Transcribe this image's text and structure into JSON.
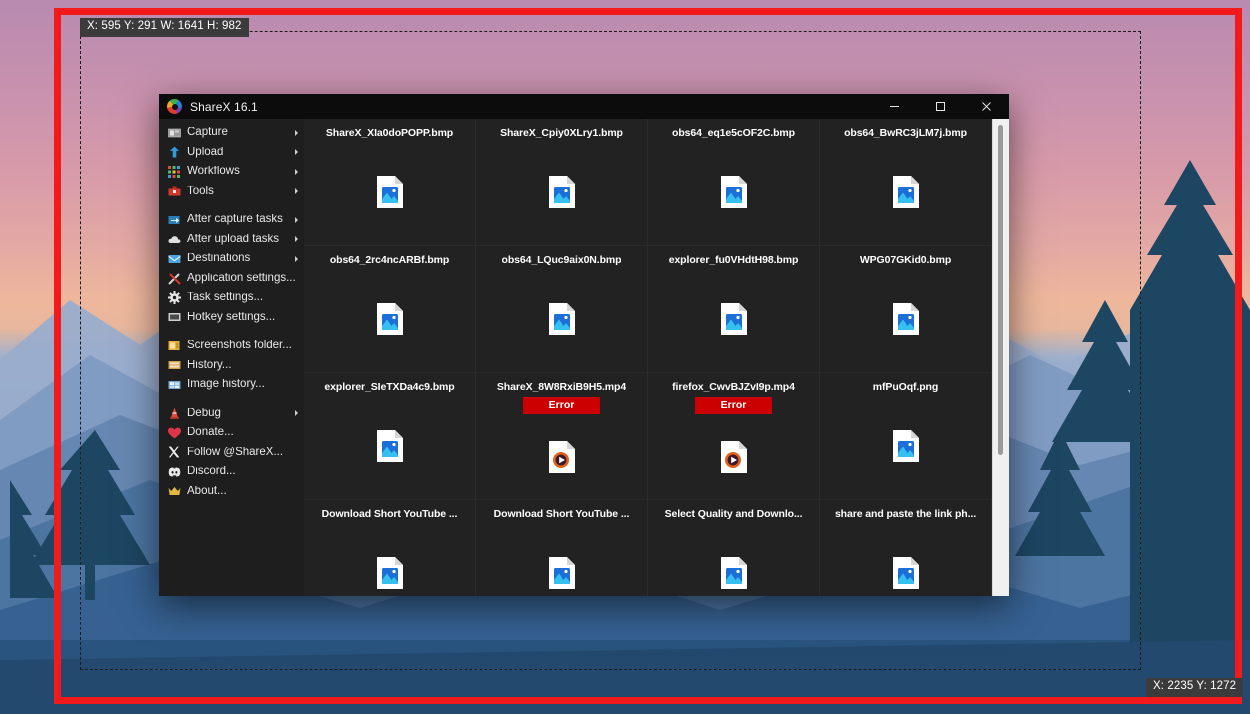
{
  "capture_overlay": {
    "region_label": "X: 595 Y: 291 W: 1641 H: 982",
    "cursor_label": "X: 2235 Y: 1272",
    "frame_color": "#f21a1a",
    "selection_border": "#ffffff"
  },
  "window": {
    "title": "ShareX 16.1",
    "logo_icon": "sharex-logo-icon",
    "controls": {
      "minimize": "minimize-icon",
      "maximize": "maximize-icon",
      "close": "close-icon"
    }
  },
  "menu": {
    "groups": [
      {
        "items": [
          {
            "label": "Capture",
            "icon": "camera-icon",
            "glyph": "▤",
            "color": "#b9b9b9",
            "submenu": true
          },
          {
            "label": "Upload",
            "icon": "upload-arrow-icon",
            "glyph": "⬆",
            "color": "#2f9ae0",
            "submenu": true
          },
          {
            "label": "Workflows",
            "icon": "grid-dots-icon",
            "glyph": "⁙",
            "color": "#49c06a",
            "submenu": true
          },
          {
            "label": "Tools",
            "icon": "toolbox-icon",
            "glyph": "☲",
            "color": "#d8352a",
            "submenu": true
          }
        ]
      },
      {
        "items": [
          {
            "label": "After capture tasks",
            "icon": "after-capture-icon",
            "glyph": "➡",
            "color": "#3f9ad6",
            "submenu": true
          },
          {
            "label": "After upload tasks",
            "icon": "cloud-icon",
            "glyph": "☁",
            "color": "#dcdcdc",
            "submenu": true
          },
          {
            "label": "Destinations",
            "icon": "destinations-icon",
            "glyph": "✉",
            "color": "#4da3dd",
            "submenu": true
          },
          {
            "label": "Application settings...",
            "icon": "wrench-screwdriver-icon",
            "glyph": "⚒",
            "color": "#d0d0d0",
            "submenu": false
          },
          {
            "label": "Task settings...",
            "icon": "gear-icon",
            "glyph": "⚙",
            "color": "#e6e6e6",
            "submenu": false
          },
          {
            "label": "Hotkey settings...",
            "icon": "keyboard-icon",
            "glyph": "⌨",
            "color": "#cfcfcf",
            "submenu": false
          }
        ]
      },
      {
        "items": [
          {
            "label": "Screenshots folder...",
            "icon": "folder-icon",
            "glyph": "὜1",
            "color": "#e8b23a",
            "submenu": false
          },
          {
            "label": "History...",
            "icon": "history-icon",
            "glyph": "▥",
            "color": "#d3a04b",
            "submenu": false
          },
          {
            "label": "Image history...",
            "icon": "image-history-icon",
            "glyph": "▦",
            "color": "#7fb6e0",
            "submenu": false
          }
        ]
      },
      {
        "items": [
          {
            "label": "Debug",
            "icon": "traffic-cone-icon",
            "glyph": "▲",
            "color": "#e04a3a",
            "submenu": true
          },
          {
            "label": "Donate...",
            "icon": "heart-icon",
            "glyph": "♥",
            "color": "#e0344a",
            "submenu": false
          },
          {
            "label": "Follow @ShareX...",
            "icon": "x-twitter-icon",
            "glyph": "✕",
            "color": "#f0f0f0",
            "submenu": false
          },
          {
            "label": "Discord...",
            "icon": "discord-icon",
            "glyph": "●",
            "color": "#e8e8e8",
            "submenu": false
          },
          {
            "label": "About...",
            "icon": "crown-icon",
            "glyph": "♛",
            "color": "#e3b83c",
            "submenu": false
          }
        ]
      }
    ]
  },
  "grid": {
    "items": [
      {
        "name": "ShareX_XIa0doPOPP.bmp",
        "type": "image",
        "badge": null
      },
      {
        "name": "ShareX_Cpiy0XLry1.bmp",
        "type": "image",
        "badge": null
      },
      {
        "name": "obs64_eq1e5cOF2C.bmp",
        "type": "image",
        "badge": null
      },
      {
        "name": "obs64_BwRC3jLM7j.bmp",
        "type": "image",
        "badge": null
      },
      {
        "name": "obs64_2rc4ncARBf.bmp",
        "type": "image",
        "badge": null
      },
      {
        "name": "obs64_LQuc9aix0N.bmp",
        "type": "image",
        "badge": null
      },
      {
        "name": "explorer_fu0VHdtH98.bmp",
        "type": "image",
        "badge": null
      },
      {
        "name": "WPG07GKid0.bmp",
        "type": "image",
        "badge": null
      },
      {
        "name": "explorer_SIeTXDa4c9.bmp",
        "type": "image",
        "badge": null
      },
      {
        "name": "ShareX_8W8RxiB9H5.mp4",
        "type": "video",
        "badge": "Error"
      },
      {
        "name": "firefox_CwvBJZvI9p.mp4",
        "type": "video",
        "badge": "Error"
      },
      {
        "name": "mfPuOqf.png",
        "type": "image",
        "badge": null
      },
      {
        "name": "Download Short YouTube ...",
        "type": "image",
        "badge": null
      },
      {
        "name": "Download Short YouTube ...",
        "type": "image",
        "badge": null
      },
      {
        "name": "Select Quality and Downlo...",
        "type": "image",
        "badge": null
      },
      {
        "name": "share and paste the link ph...",
        "type": "image",
        "badge": null
      }
    ],
    "badge_color": "#cc0000"
  },
  "scrollbar": {
    "name": "vertical-scrollbar"
  }
}
